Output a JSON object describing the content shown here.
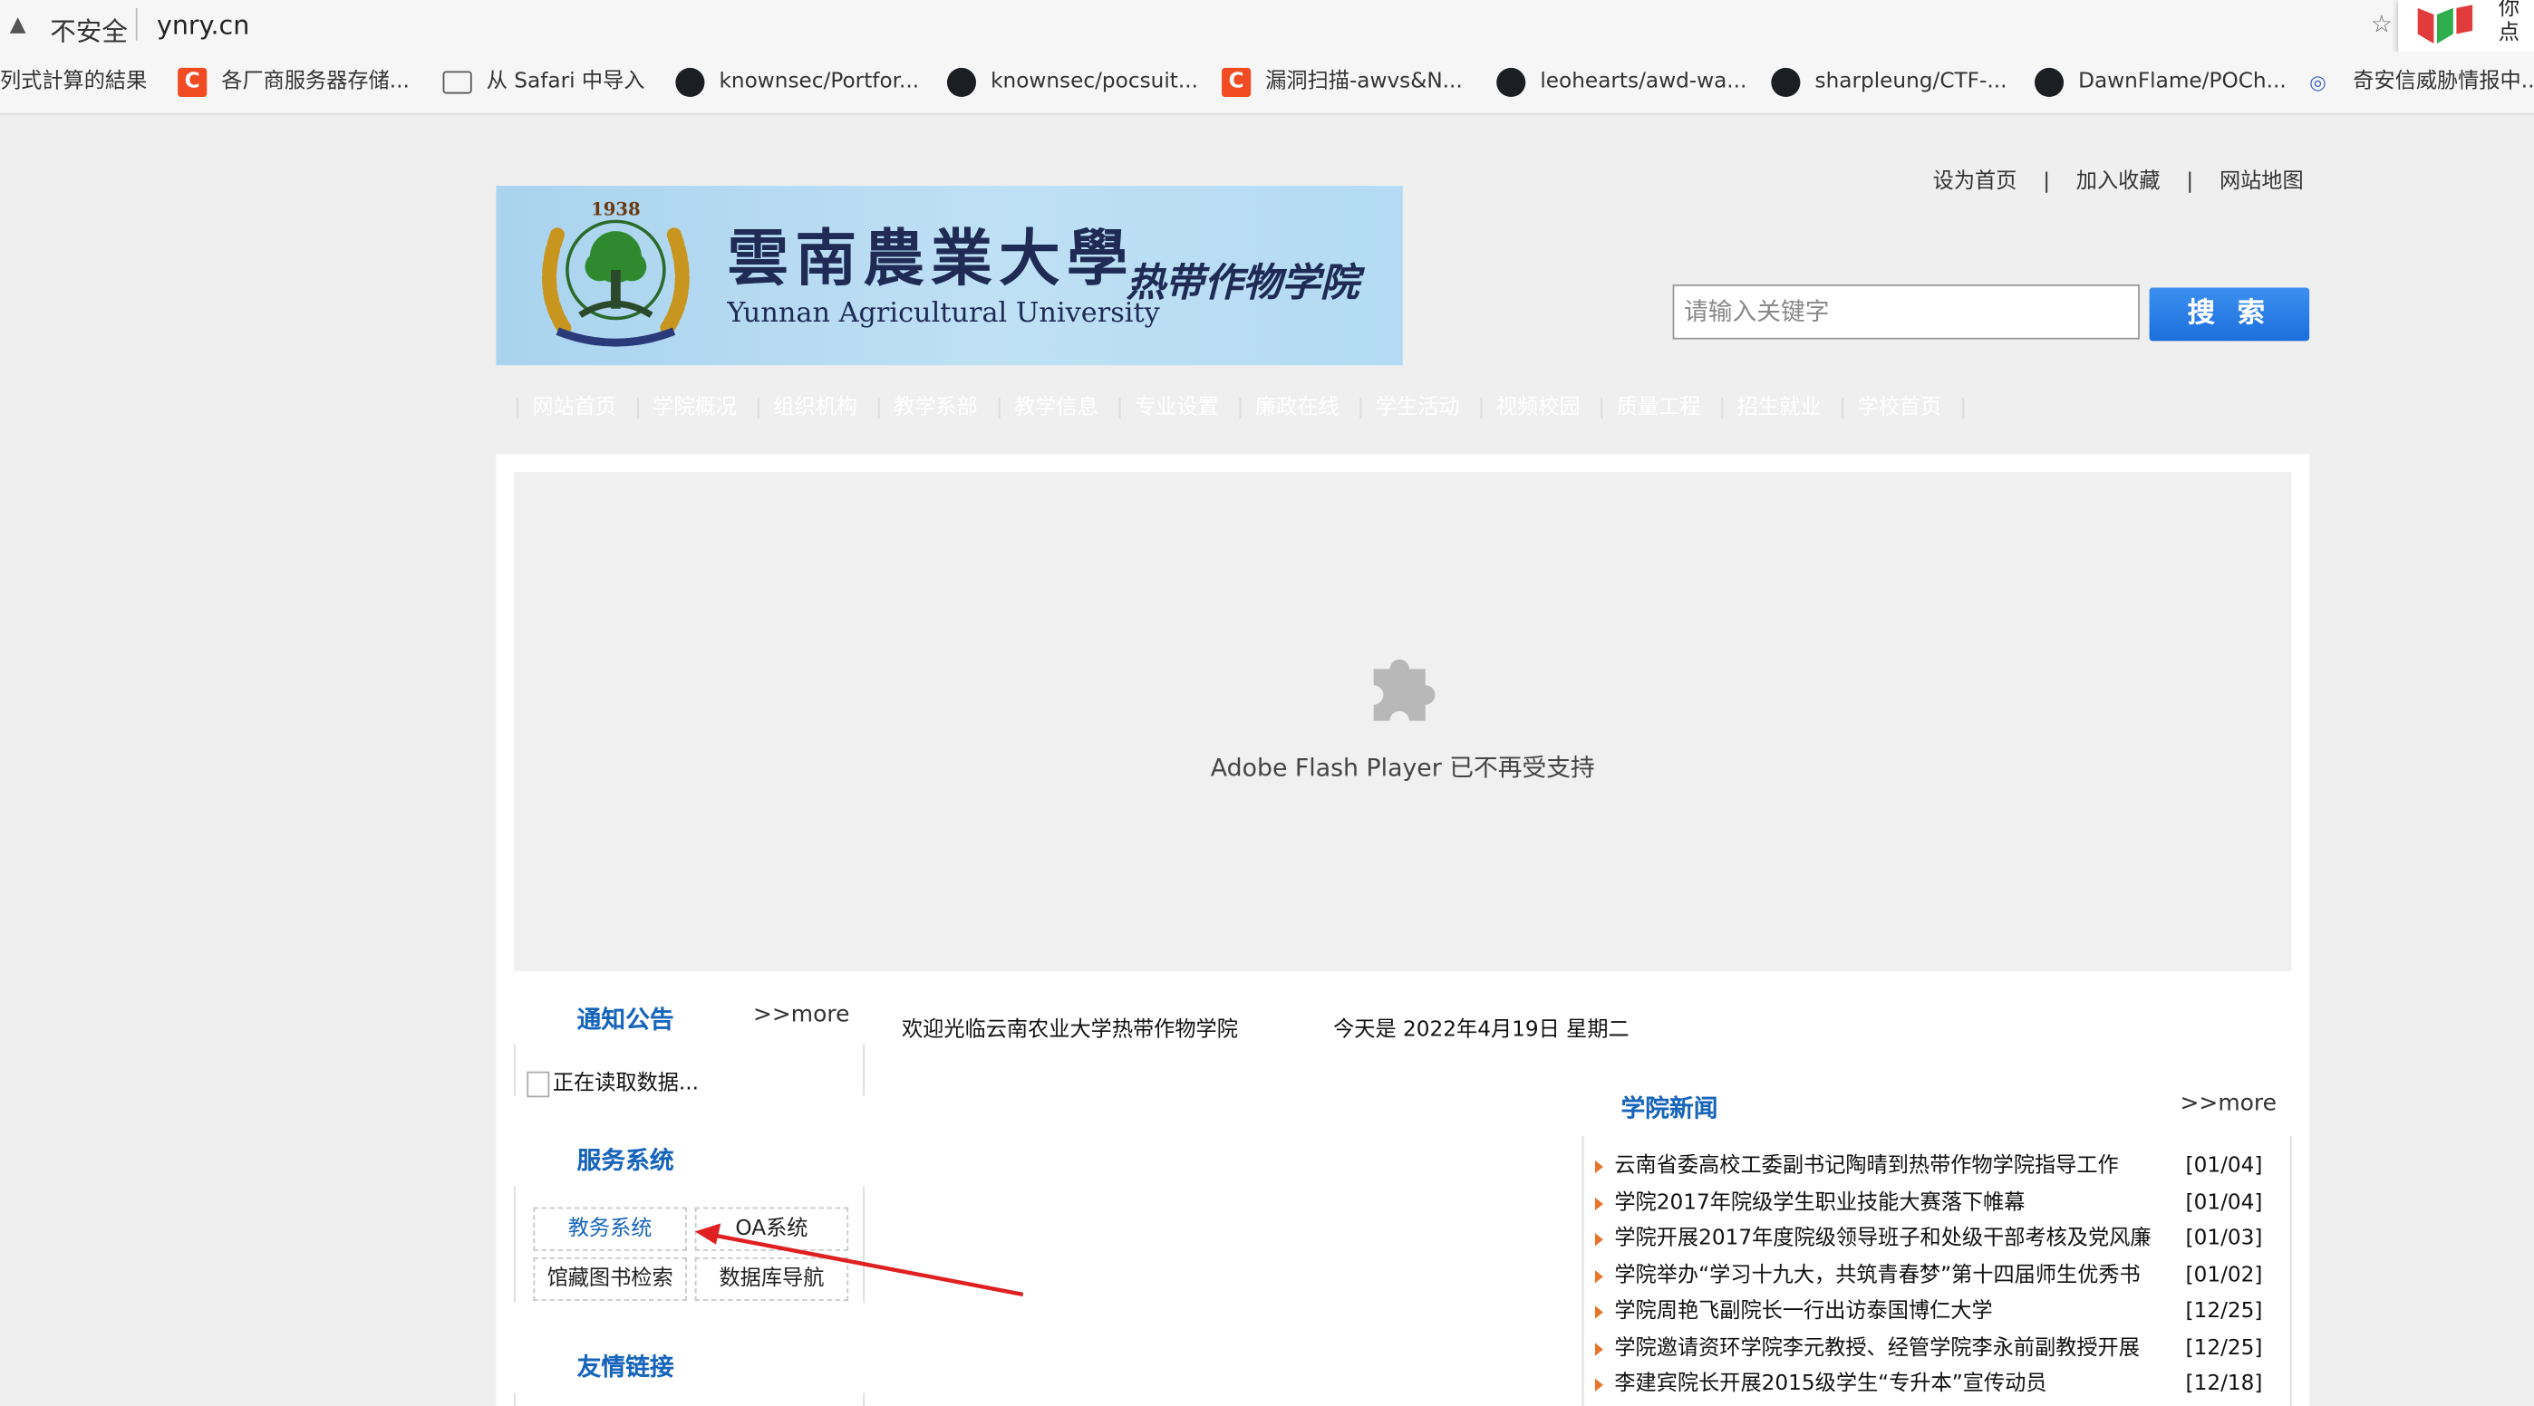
{
  "browser": {
    "security_label": "不安全",
    "url": "ynry.cn",
    "extension_popup_text": [
      "你",
      "点"
    ]
  },
  "bookmarks": [
    {
      "label": "列式計算的結果",
      "icon": "none"
    },
    {
      "label": "各厂商服务器存储...",
      "icon": "c-logo-icon"
    },
    {
      "label": "从 Safari 中导入",
      "icon": "folder-icon"
    },
    {
      "label": "knownsec/Portfor...",
      "icon": "github-icon"
    },
    {
      "label": "knownsec/pocsuit...",
      "icon": "github-icon"
    },
    {
      "label": "漏洞扫描-awvs&N...",
      "icon": "c-logo-icon"
    },
    {
      "label": "leohearts/awd-wa...",
      "icon": "github-icon"
    },
    {
      "label": "sharpleung/CTF-...",
      "icon": "github-icon"
    },
    {
      "label": "DawnFlame/POCh...",
      "icon": "github-icon"
    },
    {
      "label": "奇安信威胁情报中...",
      "icon": "qianxin-icon"
    }
  ],
  "toplinks": {
    "home": "设为首页",
    "favorite": "加入收藏",
    "sitemap": "网站地图",
    "sep": "|"
  },
  "banner": {
    "year": "1938",
    "name_cn": "雲南農業大學",
    "name_en": "Yunnan Agricultural University",
    "college": "热带作物学院"
  },
  "search": {
    "placeholder": "请输入关键字",
    "button": "搜 索"
  },
  "nav": [
    "网站首页",
    "学院概况",
    "组织机构",
    "教学系部",
    "教学信息",
    "专业设置",
    "廉政在线",
    "学生活动",
    "视频校园",
    "质量工程",
    "招生就业",
    "学校首页"
  ],
  "nav_sep": "|",
  "flash": {
    "message": "Adobe Flash Player 已不再受支持"
  },
  "notice": {
    "title": "通知公告",
    "more": ">>more",
    "loading": "正在读取数据..."
  },
  "services": {
    "title": "服务系统",
    "items": [
      "教务系统",
      "OA系统",
      "馆藏图书检索",
      "数据库导航"
    ]
  },
  "links": {
    "title": "友情链接"
  },
  "welcome": "欢迎光临云南农业大学热带作物学院",
  "today": "今天是 2022年4月19日 星期二",
  "news": {
    "title": "学院新闻",
    "more": ">>more",
    "items": [
      {
        "title": "云南省委高校工委副书记陶晴到热带作物学院指导工作",
        "date": "[01/04]"
      },
      {
        "title": "学院2017年院级学生职业技能大赛落下帷幕",
        "date": "[01/04]"
      },
      {
        "title": "学院开展2017年度院级领导班子和处级干部考核及党风廉",
        "date": "[01/03]"
      },
      {
        "title": "学院举办“学习十九大，共筑青春梦”第十四届师生优秀书",
        "date": "[01/02]"
      },
      {
        "title": "学院周艳飞副院长一行出访泰国博仁大学",
        "date": "[12/25]"
      },
      {
        "title": "学院邀请资环学院李元教授、经管学院李永前副教授开展",
        "date": "[12/25]"
      },
      {
        "title": "李建宾院长开展2015级学生“专升本”宣传动员",
        "date": "[12/18]"
      }
    ]
  },
  "colors": {
    "accent": "#1765bb",
    "search_button": "#1c6fdc",
    "annotation": "#e02020"
  }
}
